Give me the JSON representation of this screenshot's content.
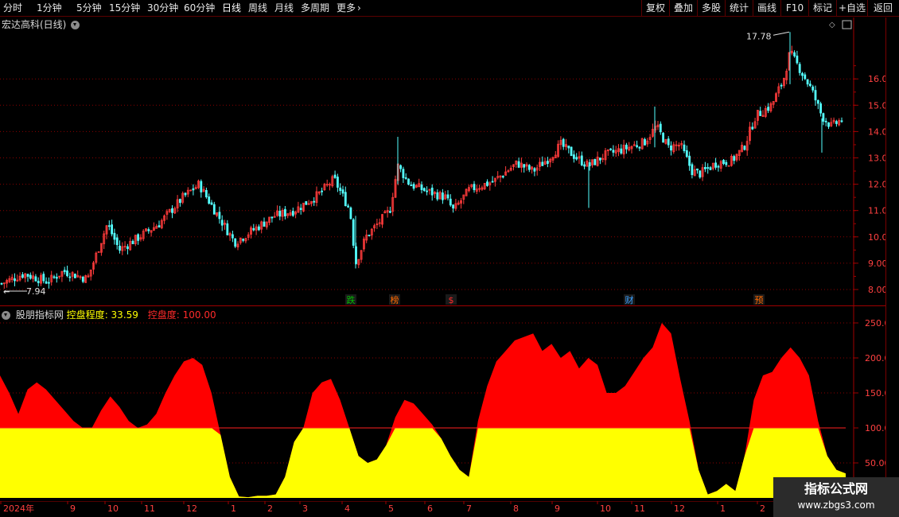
{
  "toolbar": {
    "periods": [
      "分时",
      "1分钟",
      "5分钟",
      "15分钟",
      "30分钟",
      "60分钟",
      "日线",
      "周线",
      "月线",
      "多周期",
      "更多"
    ],
    "active_period": "日线",
    "right_buttons": [
      "复权",
      "叠加",
      "多股",
      "统计",
      "画线",
      "F10",
      "标记",
      "+自选",
      "返回"
    ]
  },
  "main_chart": {
    "title": "宏达高科(日线)",
    "price_ticks": [
      "16.00",
      "15.00",
      "14.00",
      "13.00",
      "12.00",
      "11.00",
      "10.00",
      "9.00",
      "8.00"
    ],
    "high_label": "17.78",
    "low_label": "7.94",
    "event_markers": [
      {
        "text": "跌",
        "color": "#00c000"
      },
      {
        "text": "榜",
        "color": "#ff6a00"
      },
      {
        "text": "$",
        "color": "#ff2a2a"
      },
      {
        "text": "财",
        "color": "#3aa0ff"
      },
      {
        "text": "预",
        "color": "#ff6a00"
      }
    ],
    "colors": {
      "up": "#ff3b3b",
      "down": "#54ffff",
      "grid": "#8a0000"
    }
  },
  "indicator": {
    "name": "股朋指标网",
    "line1_label": "控盘程度",
    "line1_value": "33.59",
    "line2_label": "控盘度",
    "line2_value": "100.00",
    "y_ticks": [
      "250.0",
      "200.0",
      "150.0",
      "100.0",
      "50.00"
    ],
    "colors": {
      "upper": "#ff0000",
      "lower": "#ffff00"
    }
  },
  "x_axis": {
    "labels": [
      "2024年",
      "9",
      "10",
      "11",
      "12",
      "1",
      "2",
      "3",
      "4",
      "5",
      "6",
      "7",
      "8",
      "9",
      "10",
      "11",
      "12",
      "1",
      "2"
    ]
  },
  "watermark": {
    "line1": "指标公式网",
    "line2": "www.zbgs3.com"
  },
  "chart_data": {
    "type": "area",
    "title": "",
    "ylabel": "",
    "ylim": [
      0,
      250
    ],
    "reference_line": 100,
    "series": [
      {
        "name": "控盘程度",
        "color": "#ff0000",
        "values": [
          175,
          150,
          120,
          155,
          165,
          155,
          140,
          125,
          110,
          100,
          100,
          125,
          145,
          130,
          110,
          100,
          105,
          120,
          150,
          175,
          195,
          200,
          190,
          150,
          90,
          30,
          2,
          1,
          3,
          3,
          5,
          30,
          80,
          100,
          150,
          165,
          170,
          140,
          100,
          60,
          50,
          55,
          75,
          115,
          140,
          135,
          120,
          105,
          85,
          60,
          40,
          30,
          110,
          160,
          195,
          210,
          225,
          230,
          235,
          210,
          220,
          200,
          210,
          185,
          200,
          190,
          150,
          150,
          160,
          180,
          200,
          215,
          250,
          235,
          170,
          110,
          40,
          5,
          10,
          20,
          10,
          60,
          140,
          175,
          180,
          200,
          215,
          200,
          175,
          110,
          60,
          40,
          35
        ]
      },
      {
        "name": "控盘度",
        "color": "#ffff00",
        "values": [
          100,
          100,
          100,
          100,
          100,
          100,
          100,
          100,
          100,
          100,
          100,
          100,
          100,
          100,
          100,
          100,
          100,
          100,
          100,
          100,
          100,
          100,
          100,
          100,
          90,
          30,
          2,
          1,
          3,
          3,
          5,
          30,
          80,
          100,
          100,
          100,
          100,
          100,
          100,
          60,
          50,
          55,
          75,
          100,
          100,
          100,
          100,
          100,
          85,
          60,
          40,
          30,
          100,
          100,
          100,
          100,
          100,
          100,
          100,
          100,
          100,
          100,
          100,
          100,
          100,
          100,
          100,
          100,
          100,
          100,
          100,
          100,
          100,
          100,
          100,
          100,
          40,
          5,
          10,
          20,
          10,
          60,
          100,
          100,
          100,
          100,
          100,
          100,
          100,
          100,
          60,
          40,
          35
        ]
      }
    ]
  }
}
